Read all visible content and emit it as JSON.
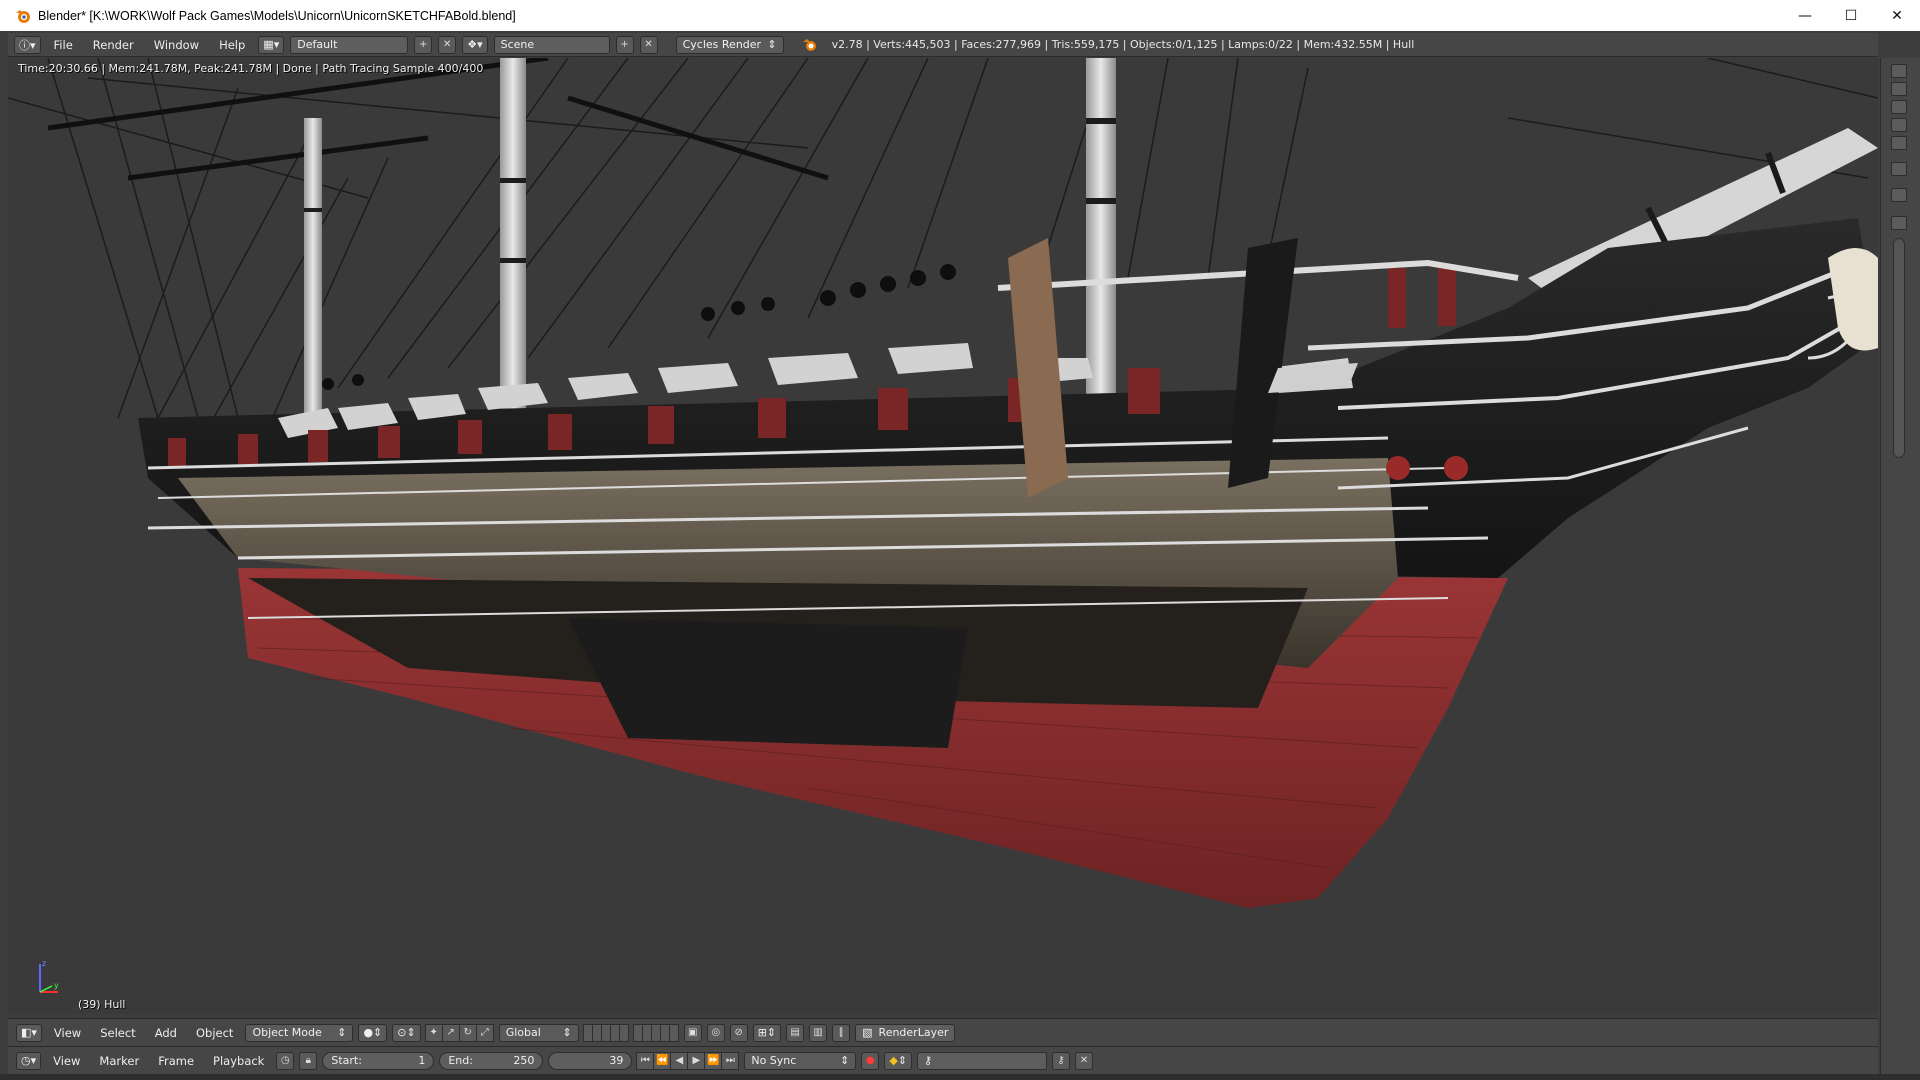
{
  "window": {
    "title": "Blender* [K:\\WORK\\Wolf Pack Games\\Models\\Unicorn\\UnicornSKETCHFABold.blend]",
    "minimize": "—",
    "maximize": "☐",
    "close": "✕"
  },
  "info_header": {
    "menus": [
      "File",
      "Render",
      "Window",
      "Help"
    ],
    "screen_layout": "Default",
    "scene": "Scene",
    "render_engine": "Cycles Render",
    "stats": "v2.78 | Verts:445,503 | Faces:277,969 | Tris:559,175 | Objects:0/1,125 | Lamps:0/22 | Mem:432.55M | Hull"
  },
  "viewport": {
    "render_info": "Time:20:30.66 | Mem:241.78M, Peak:241.78M | Done | Path Tracing Sample 400/400",
    "object_label": "(39) Hull",
    "axis_z": "z",
    "axis_y": "y"
  },
  "view_header": {
    "menus": [
      "View",
      "Select",
      "Add",
      "Object"
    ],
    "mode": "Object Mode",
    "orientation": "Global",
    "render_layer": "RenderLayer"
  },
  "timeline_header": {
    "menus": [
      "View",
      "Marker",
      "Frame",
      "Playback"
    ],
    "start_label": "Start:",
    "start_value": "1",
    "end_label": "End:",
    "end_value": "250",
    "current_frame": "39",
    "sync": "No Sync"
  },
  "colors": {
    "hull_red": "#8a2f30",
    "hull_black": "#1b1b1b",
    "deck_trim": "#d8d8d8",
    "viewport_bg": "#3a3a3a",
    "blender_orange": "#e87d0d"
  }
}
